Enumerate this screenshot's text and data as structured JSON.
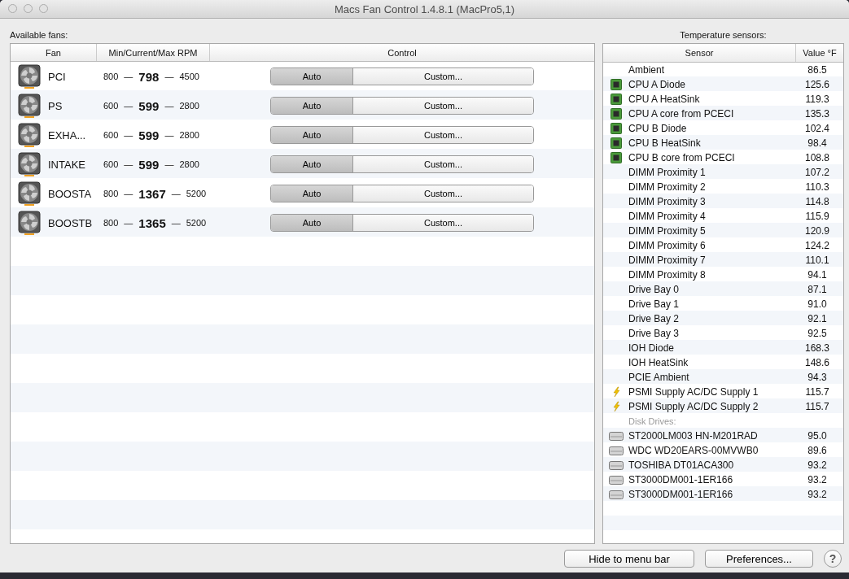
{
  "window": {
    "title": "Macs Fan Control 1.4.8.1 (MacPro5,1)"
  },
  "fans_panel": {
    "label": "Available fans:",
    "columns": [
      "Fan",
      "Min/Current/Max RPM",
      "Control"
    ],
    "rows": [
      {
        "name": "PCI",
        "separators": [
          "—",
          "—"
        ],
        "min": "800",
        "current": "798",
        "max": "4500",
        "control": [
          {
            "label": "Auto",
            "selected": true
          },
          {
            "label": "Custom...",
            "selected": false
          }
        ]
      },
      {
        "name": "PS",
        "separators": [
          "—",
          "—"
        ],
        "min": "600",
        "current": "599",
        "max": "2800",
        "control": [
          {
            "label": "Auto",
            "selected": true
          },
          {
            "label": "Custom...",
            "selected": false
          }
        ]
      },
      {
        "name": "EXHA...",
        "separators": [
          "—",
          "—"
        ],
        "min": "600",
        "current": "599",
        "max": "2800",
        "control": [
          {
            "label": "Auto",
            "selected": true
          },
          {
            "label": "Custom...",
            "selected": false
          }
        ]
      },
      {
        "name": "INTAKE",
        "separators": [
          "—",
          "—"
        ],
        "min": "600",
        "current": "599",
        "max": "2800",
        "control": [
          {
            "label": "Auto",
            "selected": true
          },
          {
            "label": "Custom...",
            "selected": false
          }
        ]
      },
      {
        "name": "BOOSTA",
        "separators": [
          "—",
          "—"
        ],
        "min": "800",
        "current": "1367",
        "max": "5200",
        "control": [
          {
            "label": "Auto",
            "selected": true
          },
          {
            "label": "Custom...",
            "selected": false
          }
        ]
      },
      {
        "name": "BOOSTB",
        "separators": [
          "—",
          "—"
        ],
        "min": "800",
        "current": "1365",
        "max": "5200",
        "control": [
          {
            "label": "Auto",
            "selected": true
          },
          {
            "label": "Custom...",
            "selected": false
          }
        ]
      }
    ]
  },
  "sensors_panel": {
    "label": "Temperature sensors:",
    "columns": [
      "Sensor",
      "Value °F"
    ],
    "rows": [
      {
        "kind": "plain",
        "name": "Ambient",
        "value": "86.5"
      },
      {
        "kind": "chip",
        "name": "CPU A Diode",
        "value": "125.6"
      },
      {
        "kind": "chip",
        "name": "CPU A HeatSink",
        "value": "119.3"
      },
      {
        "kind": "chip",
        "name": "CPU A core from PCECI",
        "value": "135.3"
      },
      {
        "kind": "chip",
        "name": "CPU B Diode",
        "value": "102.4"
      },
      {
        "kind": "chip",
        "name": "CPU B HeatSink",
        "value": "98.4"
      },
      {
        "kind": "chip",
        "name": "CPU B core from PCECI",
        "value": "108.8"
      },
      {
        "kind": "plain",
        "name": "DIMM Proximity 1",
        "value": "107.2"
      },
      {
        "kind": "plain",
        "name": "DIMM Proximity 2",
        "value": "110.3"
      },
      {
        "kind": "plain",
        "name": "DIMM Proximity 3",
        "value": "114.8"
      },
      {
        "kind": "plain",
        "name": "DIMM Proximity 4",
        "value": "115.9"
      },
      {
        "kind": "plain",
        "name": "DIMM Proximity 5",
        "value": "120.9"
      },
      {
        "kind": "plain",
        "name": "DIMM Proximity 6",
        "value": "124.2"
      },
      {
        "kind": "plain",
        "name": "DIMM Proximity 7",
        "value": "110.1"
      },
      {
        "kind": "plain",
        "name": "DIMM Proximity 8",
        "value": "94.1"
      },
      {
        "kind": "plain",
        "name": "Drive Bay 0",
        "value": "87.1"
      },
      {
        "kind": "plain",
        "name": "Drive Bay 1",
        "value": "91.0"
      },
      {
        "kind": "plain",
        "name": "Drive Bay 2",
        "value": "92.1"
      },
      {
        "kind": "plain",
        "name": "Drive Bay 3",
        "value": "92.5"
      },
      {
        "kind": "plain",
        "name": "IOH Diode",
        "value": "168.3"
      },
      {
        "kind": "plain",
        "name": "IOH HeatSink",
        "value": "148.6"
      },
      {
        "kind": "plain",
        "name": "PCIE Ambient",
        "value": "94.3"
      },
      {
        "kind": "power",
        "name": "PSMI Supply AC/DC Supply 1",
        "value": "115.7"
      },
      {
        "kind": "power",
        "name": "PSMI Supply AC/DC Supply 2",
        "value": "115.7"
      },
      {
        "kind": "section",
        "name": "Disk Drives:"
      },
      {
        "kind": "disk",
        "name": "ST2000LM003 HN-M201RAD",
        "value": "95.0"
      },
      {
        "kind": "disk",
        "name": "WDC WD20EARS-00MVWB0",
        "value": "89.6"
      },
      {
        "kind": "disk",
        "name": "TOSHIBA DT01ACA300",
        "value": "93.2"
      },
      {
        "kind": "disk",
        "name": "ST3000DM001-1ER166",
        "value": "93.2"
      },
      {
        "kind": "disk",
        "name": "ST3000DM001-1ER166",
        "value": "93.2"
      }
    ]
  },
  "buttons": [
    "Hide to menu bar",
    "Preferences..."
  ],
  "help_button": "?"
}
